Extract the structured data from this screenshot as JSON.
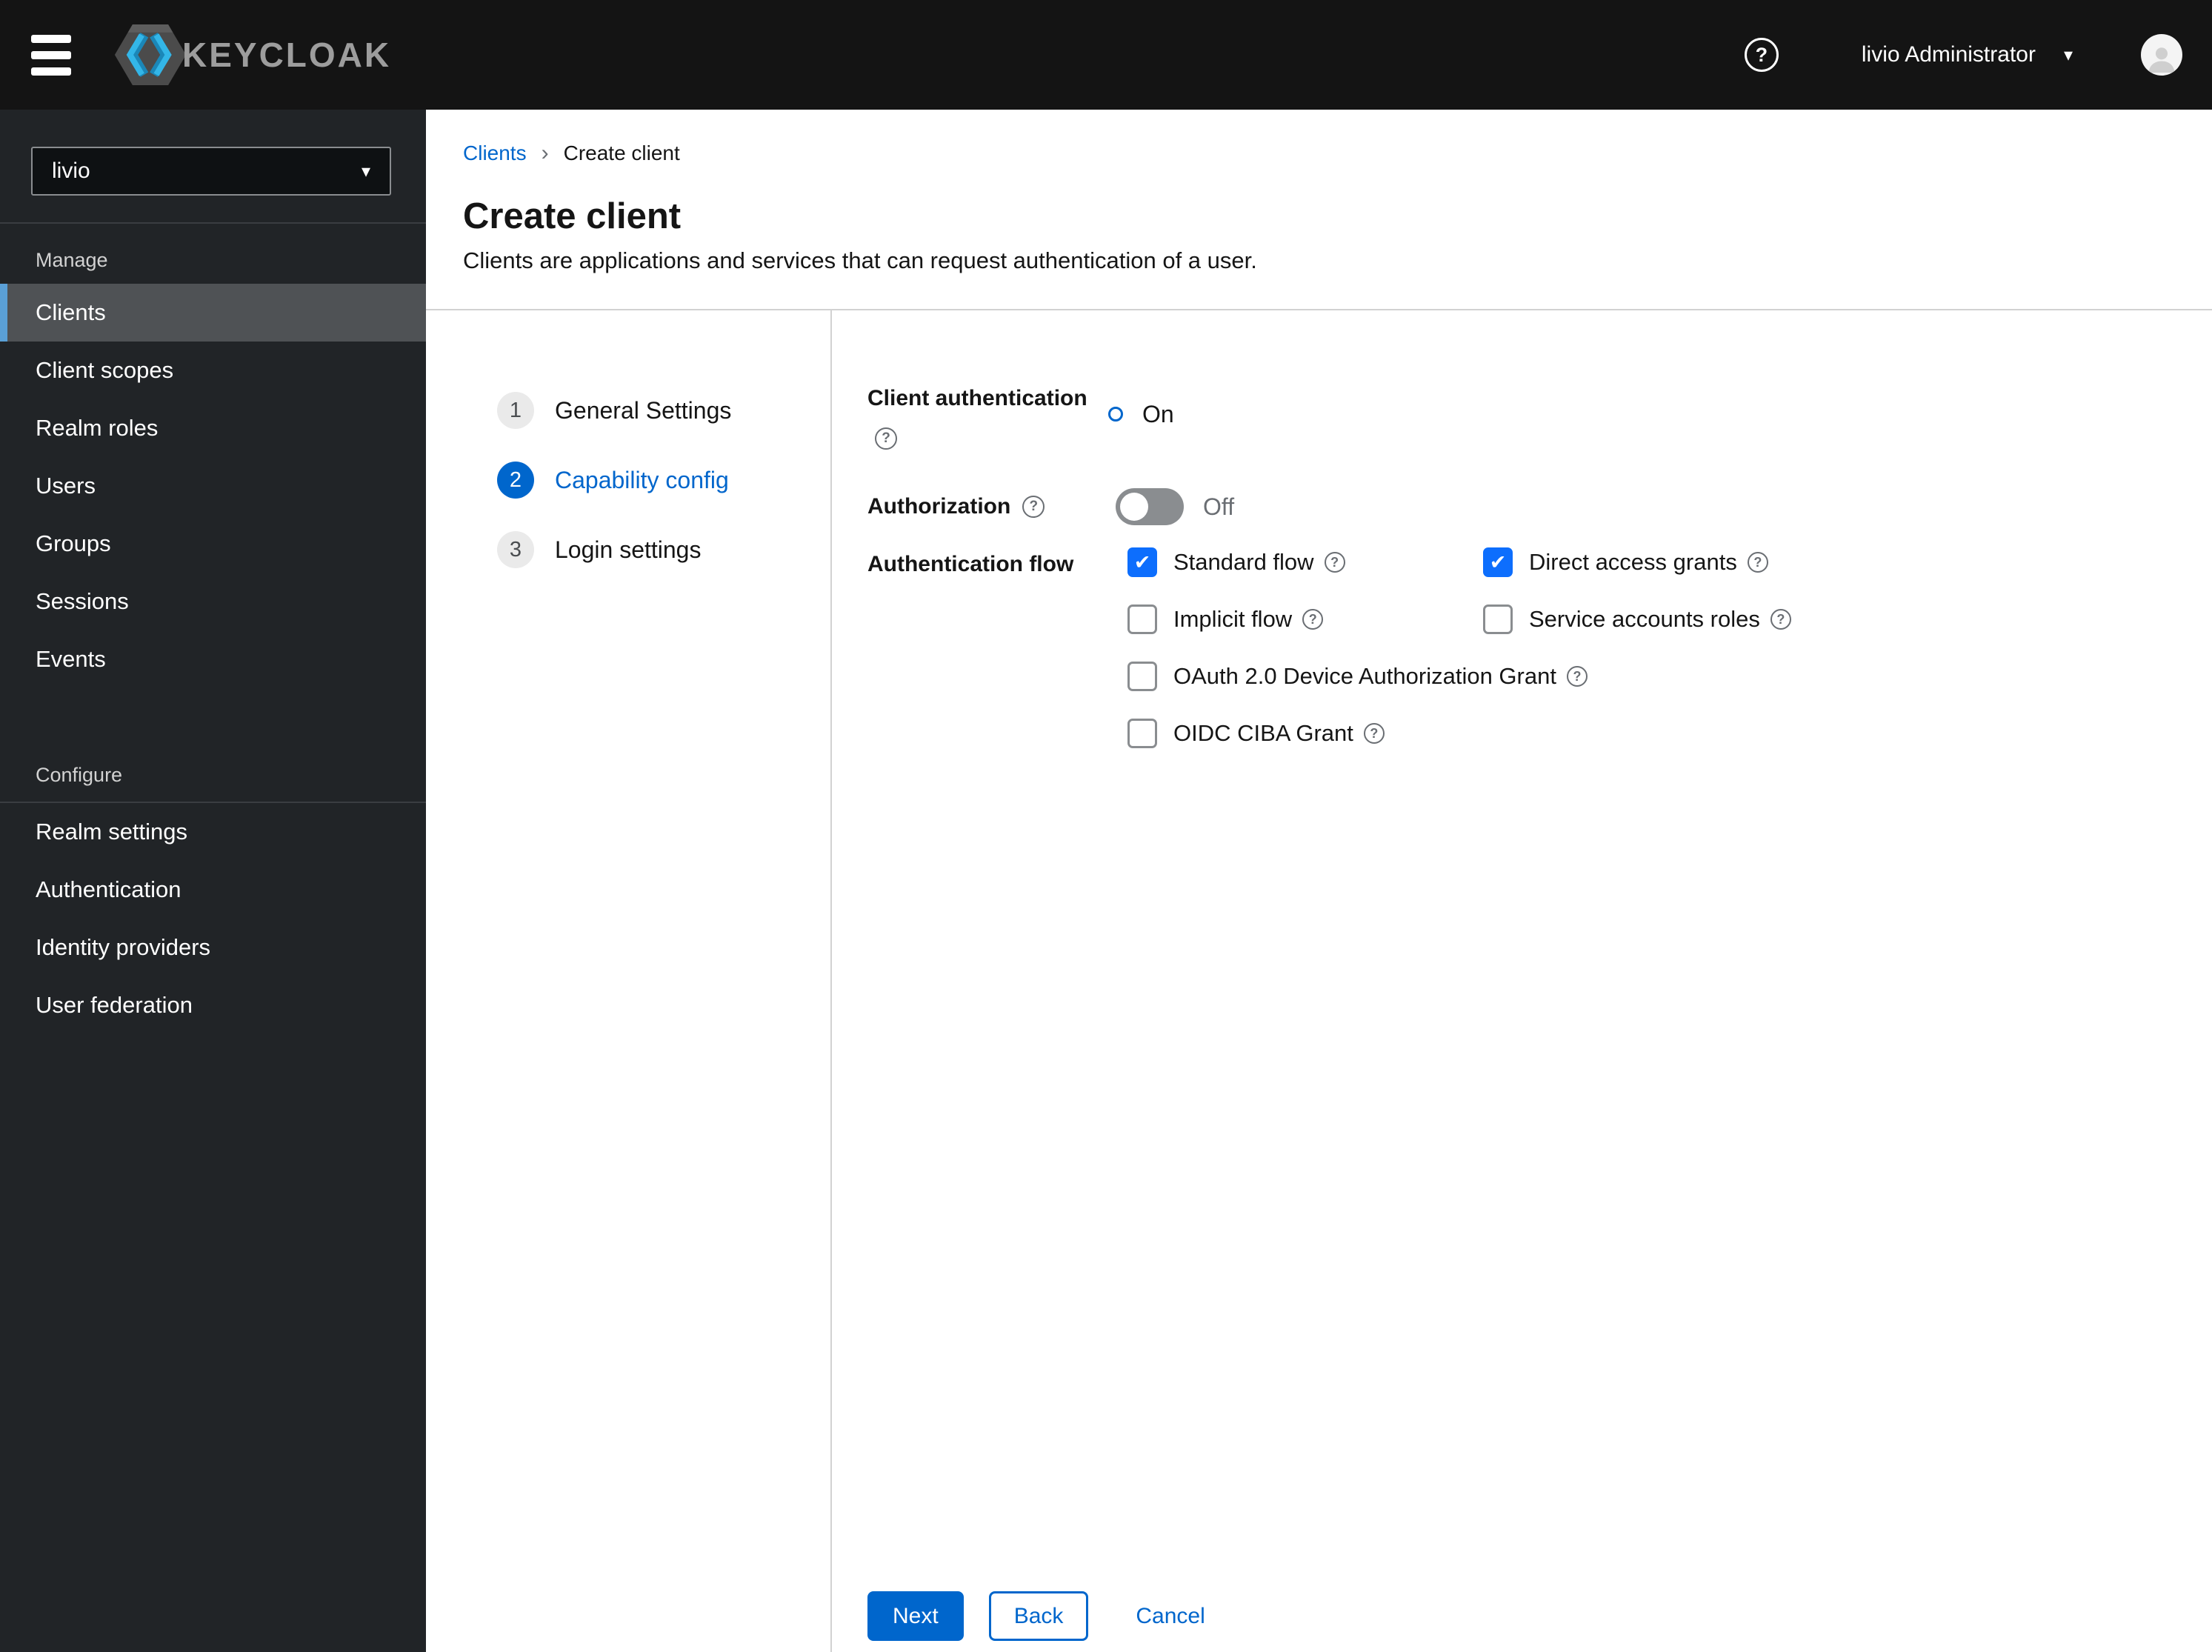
{
  "header": {
    "brand": "KEYCLOAK",
    "user": "livio Administrator"
  },
  "sidebar": {
    "realm_selector": {
      "value": "livio"
    },
    "sections": [
      {
        "title": "Manage",
        "items": [
          {
            "label": "Clients",
            "active": true
          },
          {
            "label": "Client scopes",
            "active": false
          },
          {
            "label": "Realm roles",
            "active": false
          },
          {
            "label": "Users",
            "active": false
          },
          {
            "label": "Groups",
            "active": false
          },
          {
            "label": "Sessions",
            "active": false
          },
          {
            "label": "Events",
            "active": false
          }
        ]
      },
      {
        "title": "Configure",
        "items": [
          {
            "label": "Realm settings",
            "active": false
          },
          {
            "label": "Authentication",
            "active": false
          },
          {
            "label": "Identity providers",
            "active": false
          },
          {
            "label": "User federation",
            "active": false
          }
        ]
      }
    ]
  },
  "breadcrumb": {
    "items": [
      {
        "label": "Clients",
        "link": true
      },
      {
        "label": "Create client",
        "link": false
      }
    ]
  },
  "page": {
    "title": "Create client",
    "subtitle": "Clients are applications and services that can request authentication of a user."
  },
  "wizard": {
    "steps": [
      {
        "number": "1",
        "label": "General Settings",
        "current": false
      },
      {
        "number": "2",
        "label": "Capability config",
        "current": true
      },
      {
        "number": "3",
        "label": "Login settings",
        "current": false
      }
    ]
  },
  "form": {
    "client_authentication": {
      "label": "Client authentication",
      "value": "On",
      "enabled": true
    },
    "authorization": {
      "label": "Authorization",
      "value": "Off",
      "enabled": false
    },
    "authentication_flow": {
      "label": "Authentication flow",
      "options": [
        {
          "label": "Standard flow",
          "checked": true
        },
        {
          "label": "Direct access grants",
          "checked": true
        },
        {
          "label": "Implicit flow",
          "checked": false
        },
        {
          "label": "Service accounts roles",
          "checked": false
        },
        {
          "label": "OAuth 2.0 Device Authorization Grant",
          "checked": false
        },
        {
          "label": "OIDC CIBA Grant",
          "checked": false
        }
      ]
    }
  },
  "actions": {
    "next": "Next",
    "back": "Back",
    "cancel": "Cancel"
  },
  "colors": {
    "accent": "#0066cc",
    "checkbox_checked": "#0d6efd",
    "nav_active_border": "#5aa0d7",
    "nav_active_bg": "#4f5255",
    "header_bg": "#141414",
    "sidebar_bg": "#212427",
    "toggle_off": "#8a8d90",
    "divider": "#d2d2d2",
    "text": "#151515",
    "muted": "#6a6e73",
    "logo_cyan": "#29abe2"
  }
}
